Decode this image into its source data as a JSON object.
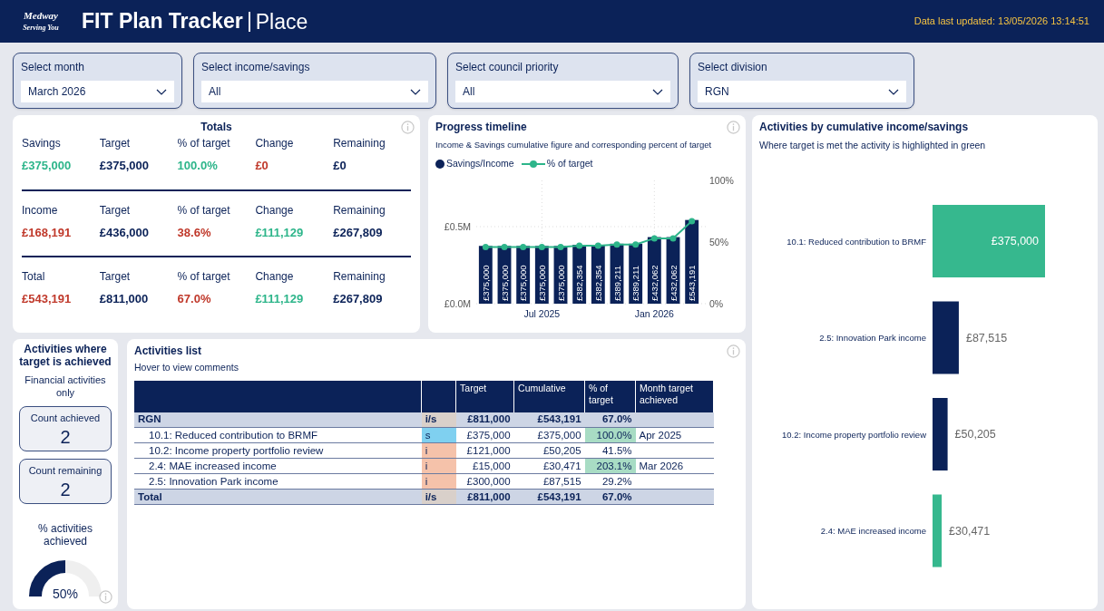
{
  "header": {
    "logo_text": "Medway",
    "logo_tagline": "Serving You",
    "title": "FIT Plan Tracker",
    "subtitle": "Place",
    "updated": "Data last updated: 13/05/2026 13:14:51"
  },
  "filters": [
    {
      "label": "Select month",
      "value": "March 2026"
    },
    {
      "label": "Select income/savings",
      "value": "All"
    },
    {
      "label": "Select council priority",
      "value": "All"
    },
    {
      "label": "Select division",
      "value": "RGN"
    }
  ],
  "totals": {
    "title": "Totals",
    "groups": [
      {
        "cells": [
          {
            "label": "Savings",
            "value": "£375,000",
            "color": "#2db58a"
          },
          {
            "label": "Target",
            "value": "£375,000",
            "color": "#0b2258"
          },
          {
            "label": "% of target",
            "value": "100.0%",
            "color": "#2db58a"
          },
          {
            "label": "Change",
            "value": "£0",
            "color": "#c0392b"
          },
          {
            "label": "Remaining",
            "value": "£0",
            "color": "#0b2258"
          }
        ]
      },
      {
        "cells": [
          {
            "label": "Income",
            "value": "£168,191",
            "color": "#c0392b"
          },
          {
            "label": "Target",
            "value": "£436,000",
            "color": "#0b2258"
          },
          {
            "label": "% of target",
            "value": "38.6%",
            "color": "#c0392b"
          },
          {
            "label": "Change",
            "value": "£111,129",
            "color": "#2db58a"
          },
          {
            "label": "Remaining",
            "value": "£267,809",
            "color": "#0b2258"
          }
        ]
      },
      {
        "cells": [
          {
            "label": "Total",
            "value": "£543,191",
            "color": "#c0392b"
          },
          {
            "label": "Target",
            "value": "£811,000",
            "color": "#0b2258"
          },
          {
            "label": "% of target",
            "value": "67.0%",
            "color": "#c0392b"
          },
          {
            "label": "Change",
            "value": "£111,129",
            "color": "#2db58a"
          },
          {
            "label": "Remaining",
            "value": "£267,809",
            "color": "#0b2258"
          }
        ]
      }
    ]
  },
  "progress": {
    "title": "Progress timeline",
    "subtitle": "Income & Savings cumulative figure and corresponding percent of target",
    "chart_data": {
      "type": "bar",
      "grid": true,
      "categories": [
        null,
        null,
        null,
        "Jul 2025",
        null,
        null,
        null,
        null,
        null,
        "Jan 2026",
        null,
        null
      ],
      "ylim": [
        0,
        800000
      ],
      "yticks": [
        {
          "value": 0,
          "label": "£0.0M"
        },
        {
          "value": 500000,
          "label": "£0.5M"
        }
      ],
      "y2lim": [
        0,
        1
      ],
      "y2ticks": [
        {
          "value": 0,
          "label": "0%"
        },
        {
          "value": 0.5,
          "label": "50%"
        },
        {
          "value": 1,
          "label": "100%"
        }
      ],
      "series": [
        {
          "name": "Savings/Income",
          "color": "#0b2258",
          "values": [
            375000,
            375000,
            375000,
            375000,
            375000,
            382354,
            382354,
            389211,
            389211,
            432062,
            432062,
            543191
          ],
          "value_labels": [
            "£375,000",
            "£375,000",
            "£375,000",
            "£375,000",
            "£375,000",
            "£382,354",
            "£382,354",
            "£389,211",
            "£389,211",
            "£432,062",
            "£432,062",
            "£543,191"
          ]
        },
        {
          "name": "% of target",
          "color": "#2db58a",
          "type": "line",
          "marker": true,
          "axis": "y2",
          "values": [
            0.46,
            0.46,
            0.46,
            0.46,
            0.46,
            0.47,
            0.47,
            0.48,
            0.48,
            0.53,
            0.53,
            0.67
          ]
        }
      ]
    }
  },
  "achieved": {
    "title": "Activities where target is achieved",
    "note": "Financial activities only",
    "cards": [
      {
        "label": "Count achieved",
        "value": "2"
      },
      {
        "label": "Count remaining",
        "value": "2"
      }
    ],
    "gauge": {
      "label": "% activities achieved",
      "reading": "50%",
      "level": 0.5
    }
  },
  "activities": {
    "title": "Activities list",
    "subtitle": "Hover to view comments",
    "columns": [
      "Target",
      "Cumulative",
      "% of target",
      "Month target achieved"
    ],
    "rows": [
      {
        "kind": "group",
        "name": "RGN",
        "type": "i/s",
        "color": "#d9d0ca",
        "target": "£811,000",
        "cumulative": "£543,191",
        "pct": "67.0%",
        "met": false
      },
      {
        "kind": "item",
        "name": "10.1: Reduced contribution to BRMF",
        "type": "s",
        "color": "#7fd0f0",
        "target": "£375,000",
        "cumulative": "£375,000",
        "pct": "100.0%",
        "met": true,
        "month": "Apr 2025"
      },
      {
        "kind": "item",
        "name": "10.2: Income property portfolio review",
        "type": "i",
        "color": "#f5c2aa",
        "target": "£121,000",
        "cumulative": "£50,205",
        "pct": "41.5%",
        "met": false
      },
      {
        "kind": "item",
        "name": "2.4: MAE increased income",
        "type": "i",
        "color": "#f5c2aa",
        "target": "£15,000",
        "cumulative": "£30,471",
        "pct": "203.1%",
        "met": true,
        "month": "Mar 2026"
      },
      {
        "kind": "item",
        "name": "2.5: Innovation Park income",
        "type": "i",
        "color": "#f5c2aa",
        "target": "£300,000",
        "cumulative": "£87,515",
        "pct": "29.2%",
        "met": false
      },
      {
        "kind": "total",
        "name": "Total",
        "type": "i/s",
        "color": "#d9d0ca",
        "target": "£811,000",
        "cumulative": "£543,191",
        "pct": "67.0%",
        "met": false
      }
    ]
  },
  "cumulative": {
    "title": "Activities by cumulative income/savings",
    "subtitle": "Where target is met the activity is highlighted in green",
    "chart_data": {
      "type": "bar",
      "orientation": "horizontal",
      "stacked": true,
      "categories": [
        "10.1: Reduced contribution to BRMF",
        "2.5: Innovation Park income",
        "10.2: Income property portfolio review",
        "2.4: MAE increased income"
      ],
      "series": [
        {
          "color": "#36b88e",
          "values": [
            375000,
            null,
            null,
            30471
          ],
          "value_labels": [
            "£375,000",
            null,
            null,
            "£30,471"
          ]
        },
        {
          "color": "#0b2258",
          "values": [
            null,
            87515,
            50205,
            null
          ],
          "value_labels": [
            null,
            "£87,515",
            "£50,205",
            null
          ]
        }
      ]
    }
  }
}
